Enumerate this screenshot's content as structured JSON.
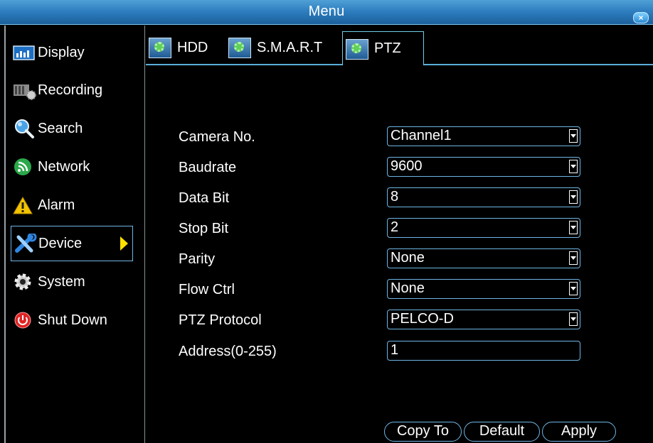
{
  "window": {
    "title": "Menu",
    "close_label": "×"
  },
  "sidebar": {
    "items": [
      {
        "label": "Display",
        "icon": "display-icon"
      },
      {
        "label": "Recording",
        "icon": "recording-icon"
      },
      {
        "label": "Search",
        "icon": "search-icon"
      },
      {
        "label": "Network",
        "icon": "network-icon"
      },
      {
        "label": "Alarm",
        "icon": "alarm-icon"
      },
      {
        "label": "Device",
        "icon": "device-icon",
        "active": true
      },
      {
        "label": "System",
        "icon": "system-icon"
      },
      {
        "label": "Shut Down",
        "icon": "power-icon"
      }
    ]
  },
  "tabs": [
    {
      "label": "HDD",
      "icon": "gear-icon"
    },
    {
      "label": "S.M.A.R.T",
      "icon": "gear-icon"
    },
    {
      "label": "PTZ",
      "icon": "gear-icon",
      "active": true
    }
  ],
  "form": {
    "camera_no": {
      "label": "Camera No.",
      "value": "Channel1"
    },
    "baudrate": {
      "label": "Baudrate",
      "value": "9600"
    },
    "data_bit": {
      "label": "Data Bit",
      "value": "8"
    },
    "stop_bit": {
      "label": "Stop Bit",
      "value": "2"
    },
    "parity": {
      "label": "Parity",
      "value": "None"
    },
    "flow_ctrl": {
      "label": "Flow Ctrl",
      "value": "None"
    },
    "ptz_protocol": {
      "label": "PTZ Protocol",
      "value": "PELCO-D"
    },
    "address": {
      "label": "Address(0-255)",
      "value": "1"
    }
  },
  "buttons": {
    "copy_to": "Copy To",
    "default": "Default",
    "apply": "Apply"
  },
  "colors": {
    "titlebar": "#2f7fc0",
    "accent_border": "#6fb6e6",
    "active_arrow": "#ffe000",
    "background": "#000000"
  }
}
